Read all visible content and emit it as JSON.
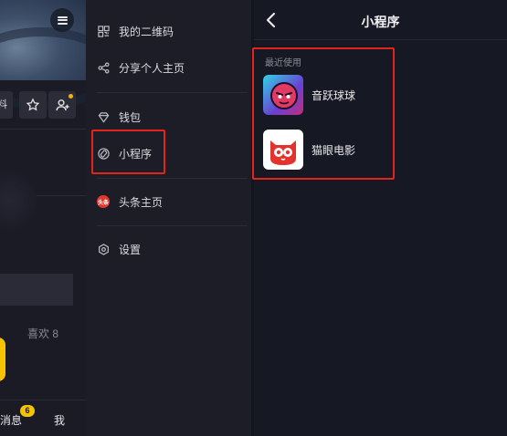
{
  "profile_bg": {
    "edit_label": "料",
    "likes_label": "喜欢 8",
    "messages_label": "消息",
    "messages_badge": "6",
    "me_label": "我"
  },
  "drawer": {
    "items": [
      {
        "label": "我的二维码",
        "icon": "qr-code-icon"
      },
      {
        "label": "分享个人主页",
        "icon": "share-icon"
      },
      {
        "label": "钱包",
        "icon": "wallet-icon"
      },
      {
        "label": "小程序",
        "icon": "mini-program-icon"
      },
      {
        "label": "头条主页",
        "icon": "toutiao-icon",
        "icon_text": "头条"
      },
      {
        "label": "设置",
        "icon": "settings-icon"
      }
    ]
  },
  "mini_programs": {
    "title": "小程序",
    "section_label": "最近使用",
    "apps": [
      {
        "name": "音跃球球",
        "icon": "yinyue-qiuqiu-app-icon"
      },
      {
        "name": "猫眼电影",
        "icon": "maoyan-movie-app-icon"
      }
    ]
  },
  "colors": {
    "background": "#161823",
    "drawer": "#1c1d27",
    "highlight_red": "#e2251c",
    "accent_yellow": "#f6c300"
  }
}
